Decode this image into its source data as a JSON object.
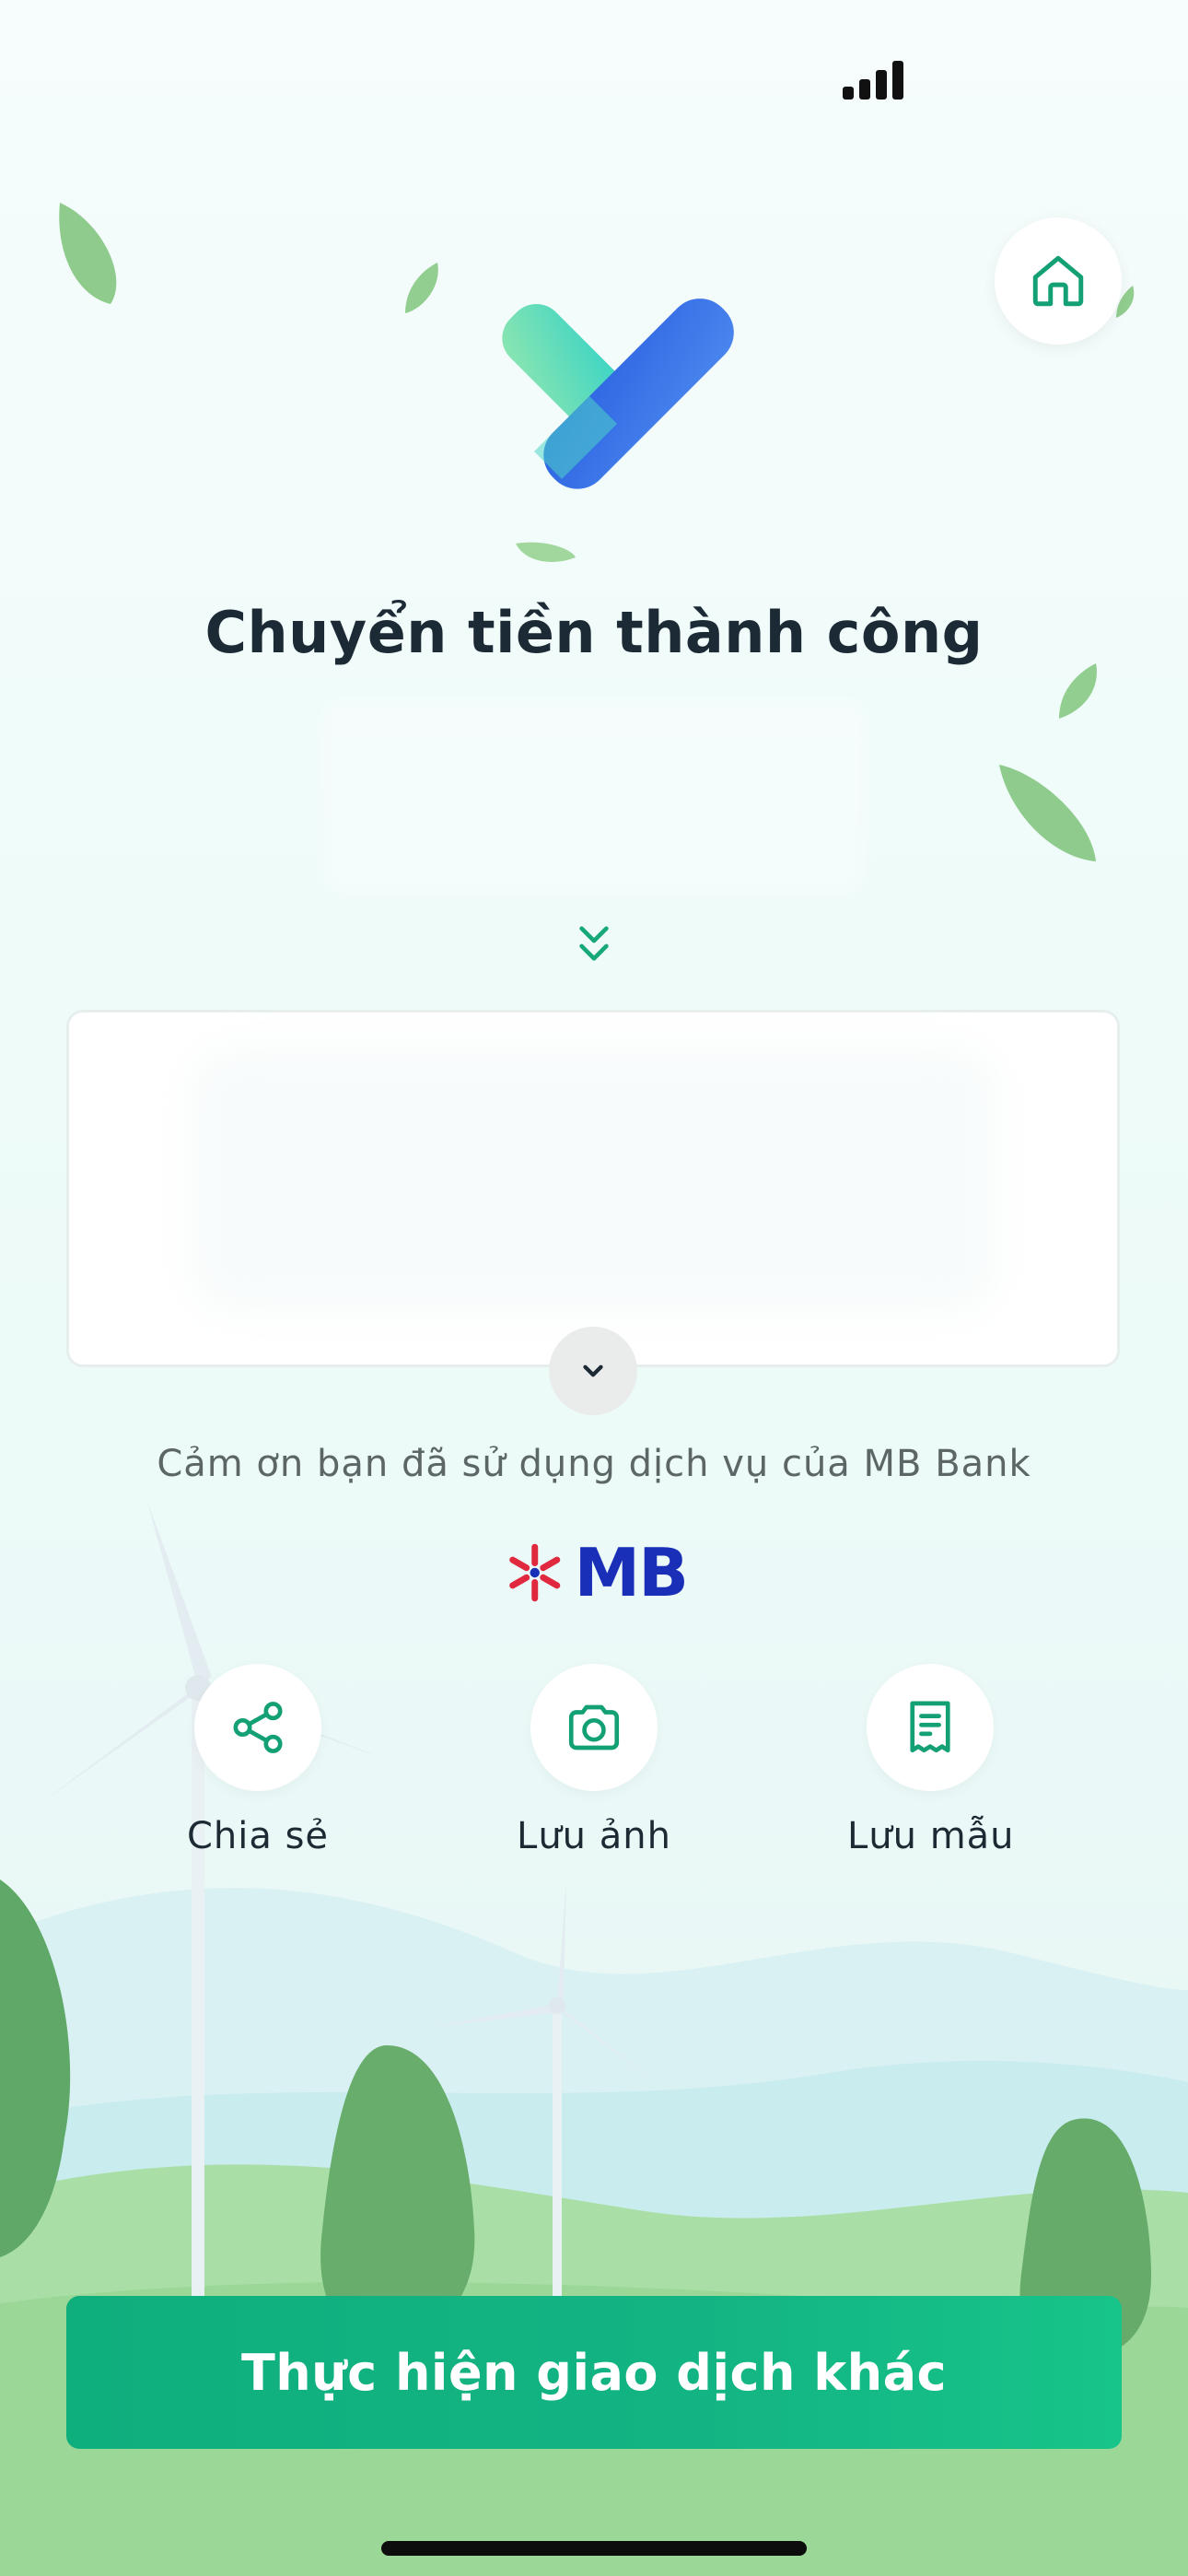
{
  "status_bar": {
    "signal_icon": "cellular-signal-icon"
  },
  "header": {
    "home_icon": "home-icon"
  },
  "result": {
    "title": "Chuyển tiền thành công",
    "icon": "checkmark-icon"
  },
  "details_card": {
    "expand_icon": "chevron-down-icon"
  },
  "footer": {
    "thanks_text": "Cảm ơn bạn đã sử dụng dịch vụ của MB Bank",
    "logo_text": "MB"
  },
  "actions": [
    {
      "label": "Chia sẻ",
      "icon": "share-icon"
    },
    {
      "label": "Lưu ảnh",
      "icon": "camera-icon"
    },
    {
      "label": "Lưu mẫu",
      "icon": "receipt-icon"
    }
  ],
  "primary_button": {
    "label": "Thực hiện giao dịch khác"
  },
  "colors": {
    "accent_green": "#13b483",
    "mb_blue": "#1a2fb8",
    "mb_red": "#e0283f",
    "title_text": "#1c2a36"
  }
}
